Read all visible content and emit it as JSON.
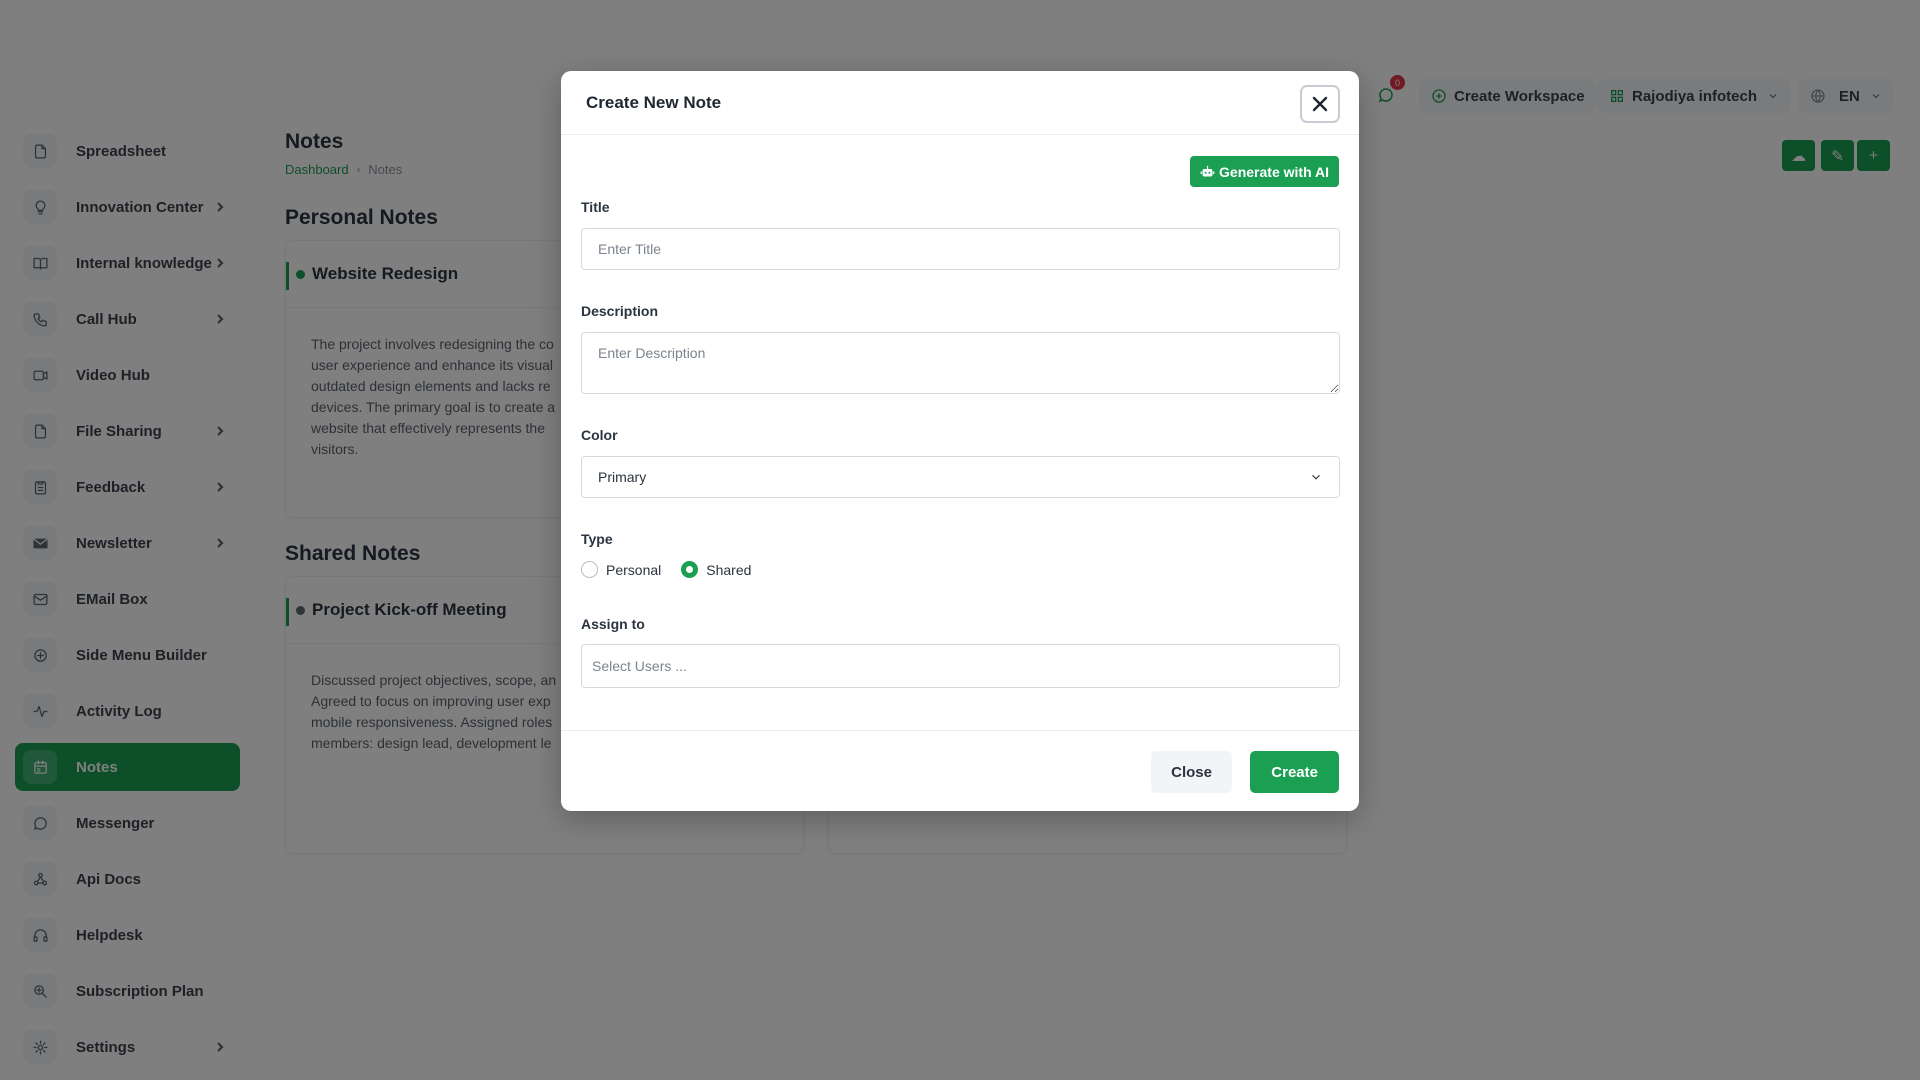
{
  "colors": {
    "accent": "#1a9f53",
    "badge": "#e0344b",
    "overlay": "rgba(0,0,0,0.5)"
  },
  "sidebar": {
    "items": [
      {
        "label": "Spreadsheet",
        "icon": "file-icon",
        "chevron": false
      },
      {
        "label": "Innovation Center",
        "icon": "lightbulb-icon",
        "chevron": true
      },
      {
        "label": "Internal knowledge",
        "icon": "book-icon",
        "chevron": true
      },
      {
        "label": "Call Hub",
        "icon": "phone-icon",
        "chevron": true
      },
      {
        "label": "Video Hub",
        "icon": "video-icon",
        "chevron": false
      },
      {
        "label": "File Sharing",
        "icon": "file-icon",
        "chevron": true
      },
      {
        "label": "Feedback",
        "icon": "clipboard-icon",
        "chevron": true
      },
      {
        "label": "Newsletter",
        "icon": "envelope-icon",
        "chevron": true
      },
      {
        "label": "EMail Box",
        "icon": "mail-icon",
        "chevron": false
      },
      {
        "label": "Side Menu Builder",
        "icon": "plus-circle-icon",
        "chevron": false
      },
      {
        "label": "Activity Log",
        "icon": "activity-icon",
        "chevron": false
      },
      {
        "label": "Notes",
        "icon": "calendar-icon",
        "chevron": false,
        "active": true
      },
      {
        "label": "Messenger",
        "icon": "chat-icon",
        "chevron": false
      },
      {
        "label": "Api Docs",
        "icon": "webhook-icon",
        "chevron": false
      },
      {
        "label": "Helpdesk",
        "icon": "headset-icon",
        "chevron": false
      },
      {
        "label": "Subscription Plan",
        "icon": "zoom-icon",
        "chevron": false
      },
      {
        "label": "Settings",
        "icon": "gear-icon",
        "chevron": true
      }
    ]
  },
  "topbar": {
    "message_count": "0",
    "create_workspace": "Create Workspace",
    "workspace_name": "Rajodiya infotech",
    "language": "EN"
  },
  "page": {
    "title": "Notes",
    "breadcrumb": {
      "home": "Dashboard",
      "current": "Notes"
    }
  },
  "personal": {
    "heading": "Personal Notes",
    "card": {
      "title": "Website Redesign",
      "body": "The project involves redesigning the co… user experience and enhance its visual… outdated design elements and lacks re… devices. The primary goal is to create a… website that effectively represents the… visitors.",
      "lines": [
        "The project involves redesigning the co",
        "user experience and enhance its visual",
        "outdated design elements and lacks re",
        "devices. The primary goal is to create a",
        "website that effectively represents the",
        "visitors."
      ]
    }
  },
  "shared": {
    "heading": "Shared Notes",
    "card": {
      "title": "Project Kick-off Meeting",
      "lines": [
        "Discussed project objectives, scope, an",
        "Agreed to focus on improving user exp",
        "mobile responsiveness. Assigned roles",
        "members: design lead, development le"
      ]
    }
  },
  "modal": {
    "title": "Create New Note",
    "ai_button": "Generate with AI",
    "title_label": "Title",
    "title_placeholder": "Enter Title",
    "description_label": "Description",
    "description_placeholder": "Enter Description",
    "color_label": "Color",
    "color_value": "Primary",
    "type_label": "Type",
    "type_options": [
      {
        "label": "Personal",
        "checked": false
      },
      {
        "label": "Shared",
        "checked": true
      }
    ],
    "assign_label": "Assign to",
    "assign_placeholder": "Select Users ...",
    "close_button": "Close",
    "create_button": "Create"
  }
}
